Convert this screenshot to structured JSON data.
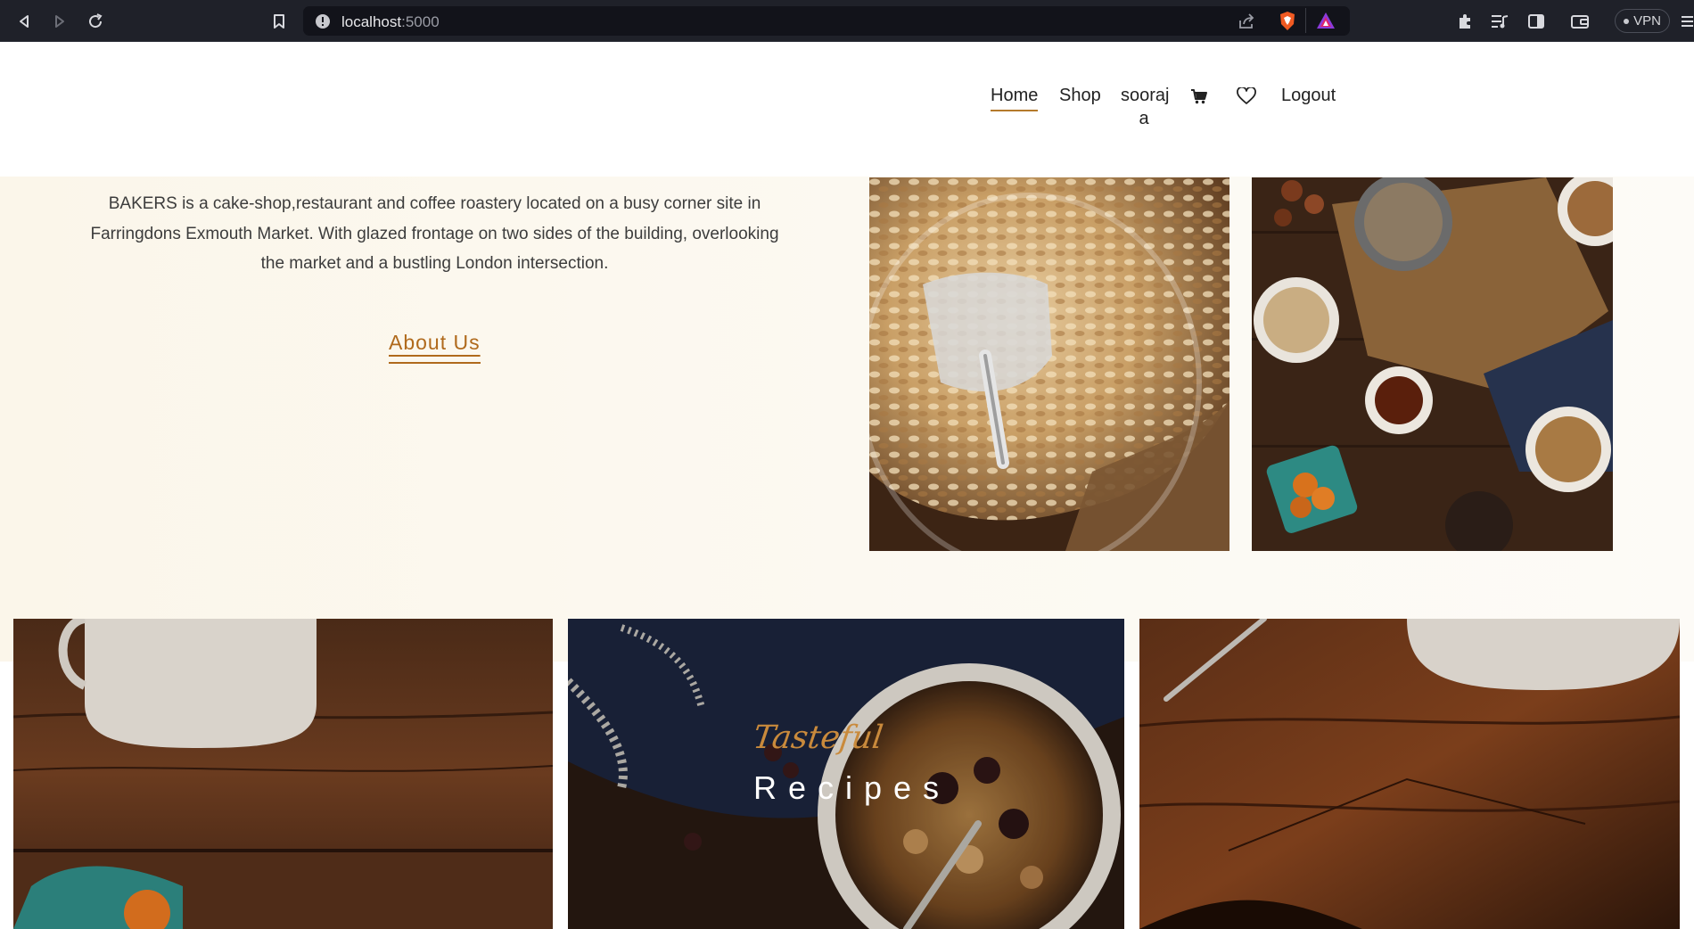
{
  "browser": {
    "url_host": "localhost",
    "url_port": ":5000",
    "vpn_label": "VPN",
    "icons": [
      "back-icon",
      "forward-icon",
      "reload-icon",
      "bookmark-icon",
      "site-info-icon",
      "share-icon",
      "brave-shields-icon",
      "brave-rewards-icon",
      "extensions-icon",
      "playlist-icon",
      "sidebar-icon",
      "wallet-icon",
      "menu-icon"
    ]
  },
  "nav": {
    "home": "Home",
    "shop": "Shop",
    "user_line1": "sooraj",
    "user_line2": "a",
    "logout": "Logout",
    "accent_color": "#b57a2b",
    "icons": [
      "cart-icon",
      "heart-icon"
    ]
  },
  "about": {
    "text": "BAKERS is a cake-shop,restaurant and coffee roastery located on a busy corner site in Farringdons Exmouth Market. With glazed frontage on two sides of the building, overlooking the market and a bustling London intersection.",
    "link": "About Us",
    "link_color": "#b06a1c"
  },
  "recipes": {
    "script_label": "Tasteful",
    "title": "Recipes",
    "script_color": "#c98a3c"
  }
}
